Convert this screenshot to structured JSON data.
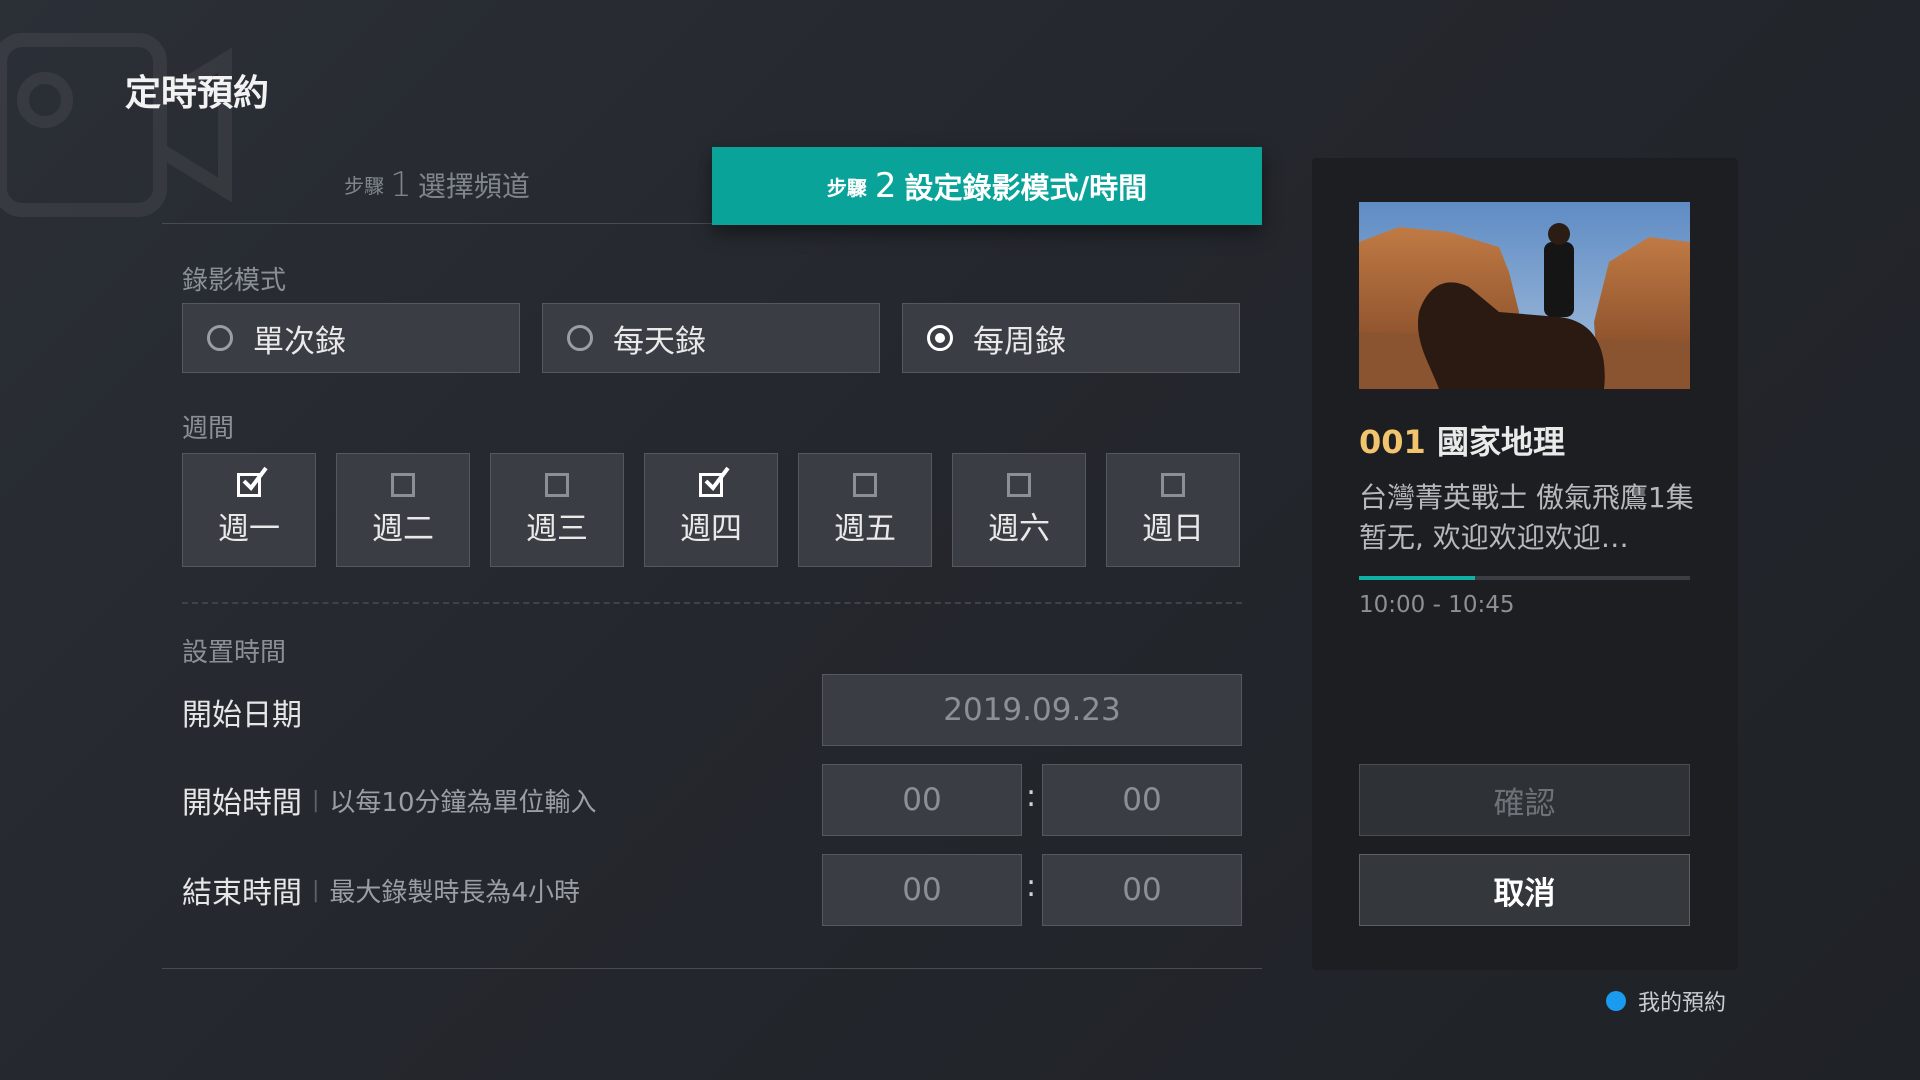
{
  "page": {
    "title": "定時預約"
  },
  "steps": [
    {
      "prefix": "步驟",
      "number": "1",
      "label": "選擇頻道",
      "active": false
    },
    {
      "prefix": "步驟",
      "number": "2",
      "label": "設定錄影模式/時間",
      "active": true
    }
  ],
  "record_mode": {
    "label": "錄影模式",
    "options": [
      {
        "label": "單次錄",
        "selected": false
      },
      {
        "label": "每天錄",
        "selected": false
      },
      {
        "label": "每周錄",
        "selected": true
      }
    ]
  },
  "weekdays": {
    "label": "週間",
    "days": [
      {
        "label": "週一",
        "checked": true
      },
      {
        "label": "週二",
        "checked": false
      },
      {
        "label": "週三",
        "checked": false
      },
      {
        "label": "週四",
        "checked": true
      },
      {
        "label": "週五",
        "checked": false
      },
      {
        "label": "週六",
        "checked": false
      },
      {
        "label": "週日",
        "checked": false
      }
    ]
  },
  "time_settings": {
    "label": "設置時間",
    "start_date": {
      "label": "開始日期",
      "value": "2019.09.23"
    },
    "start_time": {
      "label": "開始時間",
      "hint": "以每10分鐘為單位輸入",
      "hour": "00",
      "minute": "00"
    },
    "end_time": {
      "label": "結束時間",
      "hint": "最大錄製時長為4小時",
      "hour": "00",
      "minute": "00"
    },
    "separator": ":"
  },
  "program": {
    "channel_number": "001",
    "channel_name": "國家地理",
    "description": "台灣菁英戰士 傲氣飛鷹1集 暂无, 欢迎欢迎欢迎…",
    "progress": 0.35,
    "time_range": "10:00 - 10:45",
    "thumbnail": "desert-rider-image"
  },
  "actions": {
    "confirm": "確認",
    "cancel": "取消"
  },
  "legend": {
    "label": "我的預約",
    "color": "#1b9bf0"
  },
  "colors": {
    "accent": "#0aa39a",
    "channel_number": "#f2c46e",
    "progress": "#10b0a6"
  }
}
